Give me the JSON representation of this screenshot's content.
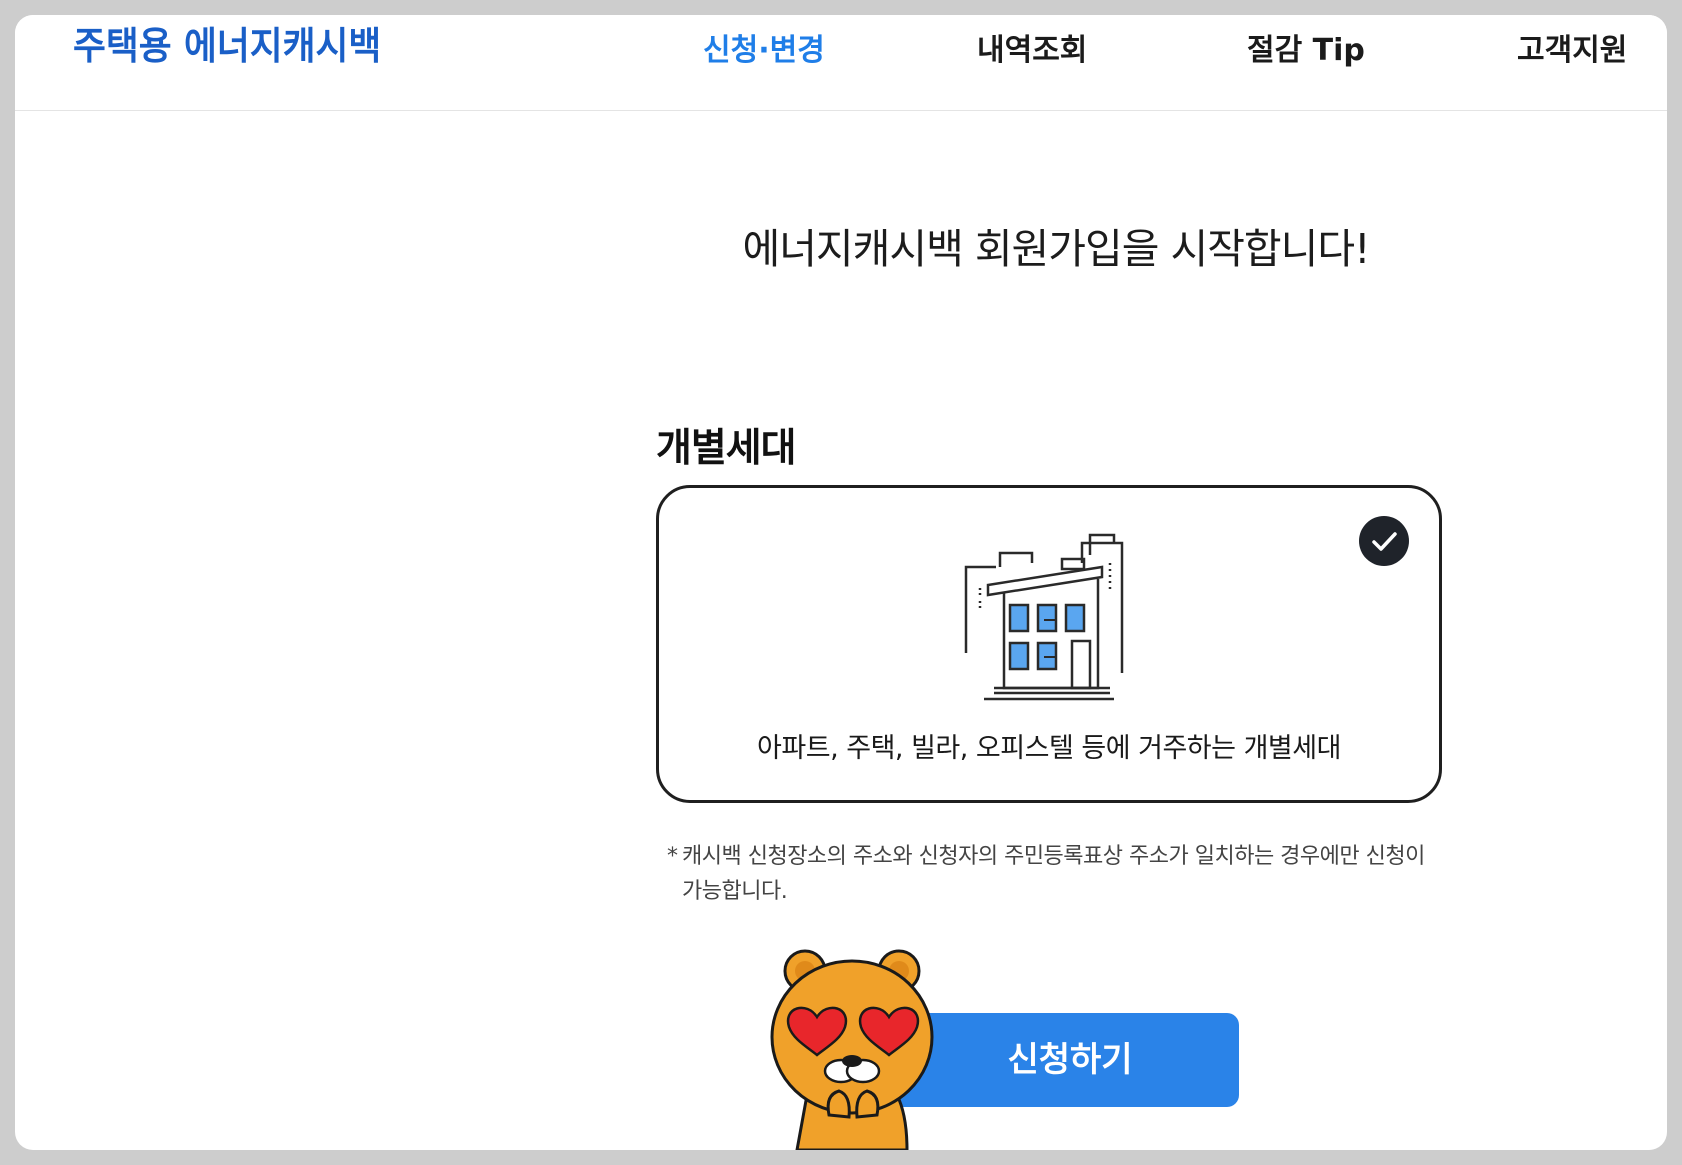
{
  "header": {
    "logo": "주택용 에너지캐시백",
    "nav": [
      {
        "label": "신청·변경",
        "active": true
      },
      {
        "label": "내역조회",
        "active": false
      },
      {
        "label": "절감 Tip",
        "active": false
      },
      {
        "label": "고객지원",
        "active": false
      }
    ]
  },
  "main": {
    "title": "에너지캐시백 회원가입을 시작합니다!",
    "section_label": "개별세대",
    "option_card": {
      "description": "아파트, 주택, 빌라, 오피스텔 등에 거주하는 개별세대",
      "selected": true,
      "icon": "building-icon",
      "check_icon": "check-circle-icon"
    },
    "note": {
      "marker": "*",
      "text": "캐시백 신청장소의 주소와 신청자의 주민등록표상 주소가 일치하는 경우에만 신청이 가능합니다."
    },
    "apply_button": "신청하기",
    "mascot_icon": "bear-mascot-icon"
  },
  "colors": {
    "brand": "#1a5fc7",
    "nav_active": "#1f7ee8",
    "button": "#2a83e8",
    "window_blue": "#5aa6f0"
  }
}
